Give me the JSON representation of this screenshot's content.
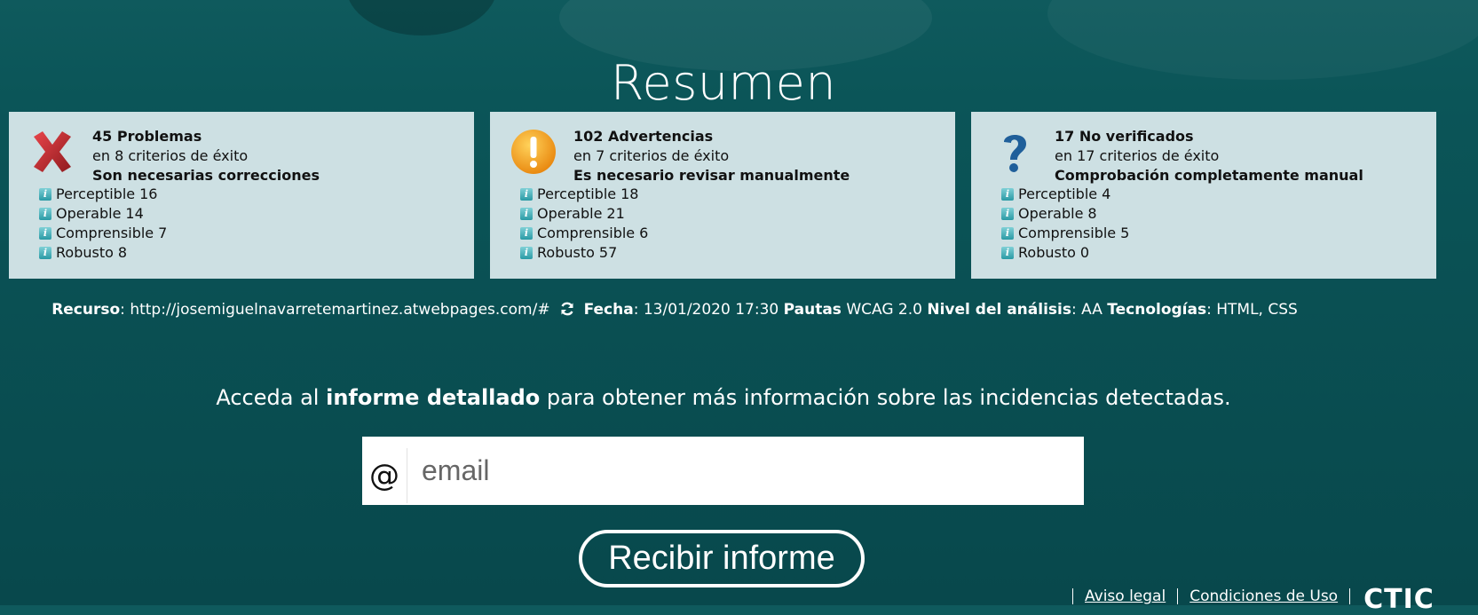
{
  "page": {
    "title": "Resumen"
  },
  "cards": [
    {
      "icon": "error-x-icon",
      "count": "45 Problemas",
      "criteria": "en 8 criterios de éxito",
      "message": "Son necesarias correcciones",
      "items": [
        {
          "label": "Perceptible",
          "value": "16"
        },
        {
          "label": "Operable",
          "value": "14"
        },
        {
          "label": "Comprensible",
          "value": "7"
        },
        {
          "label": "Robusto",
          "value": "8"
        }
      ]
    },
    {
      "icon": "warning-icon",
      "count": "102 Advertencias",
      "criteria": "en 7 criterios de éxito",
      "message": "Es necesario revisar manualmente",
      "items": [
        {
          "label": "Perceptible",
          "value": "18"
        },
        {
          "label": "Operable",
          "value": "21"
        },
        {
          "label": "Comprensible",
          "value": "6"
        },
        {
          "label": "Robusto",
          "value": "57"
        }
      ]
    },
    {
      "icon": "question-icon",
      "count": "17 No verificados",
      "criteria": "en 17 criterios de éxito",
      "message": "Comprobación completamente manual",
      "items": [
        {
          "label": "Perceptible",
          "value": "4"
        },
        {
          "label": "Operable",
          "value": "8"
        },
        {
          "label": "Comprensible",
          "value": "5"
        },
        {
          "label": "Robusto",
          "value": "0"
        }
      ]
    }
  ],
  "meta": {
    "resource_label": "Recurso",
    "resource_value": "http://josemiguelnavarretemartinez.atwebpages.com/#",
    "date_label": "Fecha",
    "date_value": "13/01/2020 17:30",
    "guidelines_label": "Pautas",
    "guidelines_value": "WCAG 2.0",
    "level_label": "Nivel del análisis",
    "level_value": "AA",
    "tech_label": "Tecnologías",
    "tech_value": "HTML, CSS"
  },
  "cta": {
    "prefix": "Acceda al",
    "bold": "informe detallado",
    "suffix": "para obtener más información sobre las incidencias detectadas."
  },
  "form": {
    "at_symbol": "@",
    "email_placeholder": "email",
    "submit_label": "Recibir informe"
  },
  "footer": {
    "legal": "Aviso legal",
    "terms": "Condiciones de Uso",
    "logo_text": "CTIC"
  },
  "colors": {
    "background": "#0b5558",
    "card": "#cde0e3",
    "error": "#c0272d",
    "warning": "#f39c12",
    "question": "#1f5f9a"
  }
}
